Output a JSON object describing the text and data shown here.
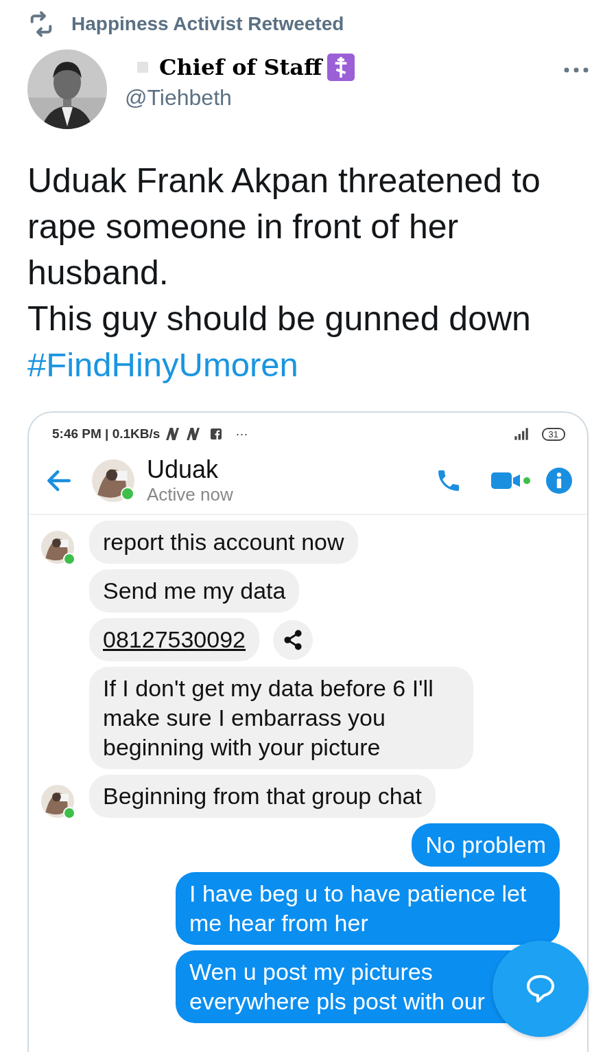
{
  "retweet": {
    "label": "Happiness Activist Retweeted"
  },
  "author": {
    "name": "Chief of Staff",
    "handle": "@Tiehbeth"
  },
  "tweet": {
    "lines": [
      "Uduak Frank Akpan threatened to rape someone in front of her husband.",
      "This guy should be gunned down"
    ],
    "hashtag": "#FindHinyUmoren"
  },
  "embedded": {
    "status_bar": {
      "time": "5:46 PM | 0.1KB/s",
      "more": "···",
      "battery": "31"
    },
    "chat_header": {
      "name": "Uduak",
      "status": "Active now",
      "online": true
    },
    "messages": [
      {
        "kind": "received",
        "text": "report this account now",
        "avatar": true
      },
      {
        "kind": "received",
        "text": "Send me my data",
        "avatar": false
      },
      {
        "kind": "link",
        "text": "08127530092",
        "avatar": false
      },
      {
        "kind": "received",
        "text": "If I don't get my data before 6 I'll make sure I embarrass you beginning with your picture",
        "avatar": false
      },
      {
        "kind": "received",
        "text": "Beginning from that group chat",
        "avatar": true
      },
      {
        "kind": "sent",
        "text": "No problem",
        "avatar": false
      },
      {
        "kind": "sent",
        "text": "I have beg u to have patience let me hear from her",
        "avatar": false
      },
      {
        "kind": "sent",
        "text": "Wen u post my pictures everywhere pls post with our",
        "avatar": false
      }
    ]
  }
}
